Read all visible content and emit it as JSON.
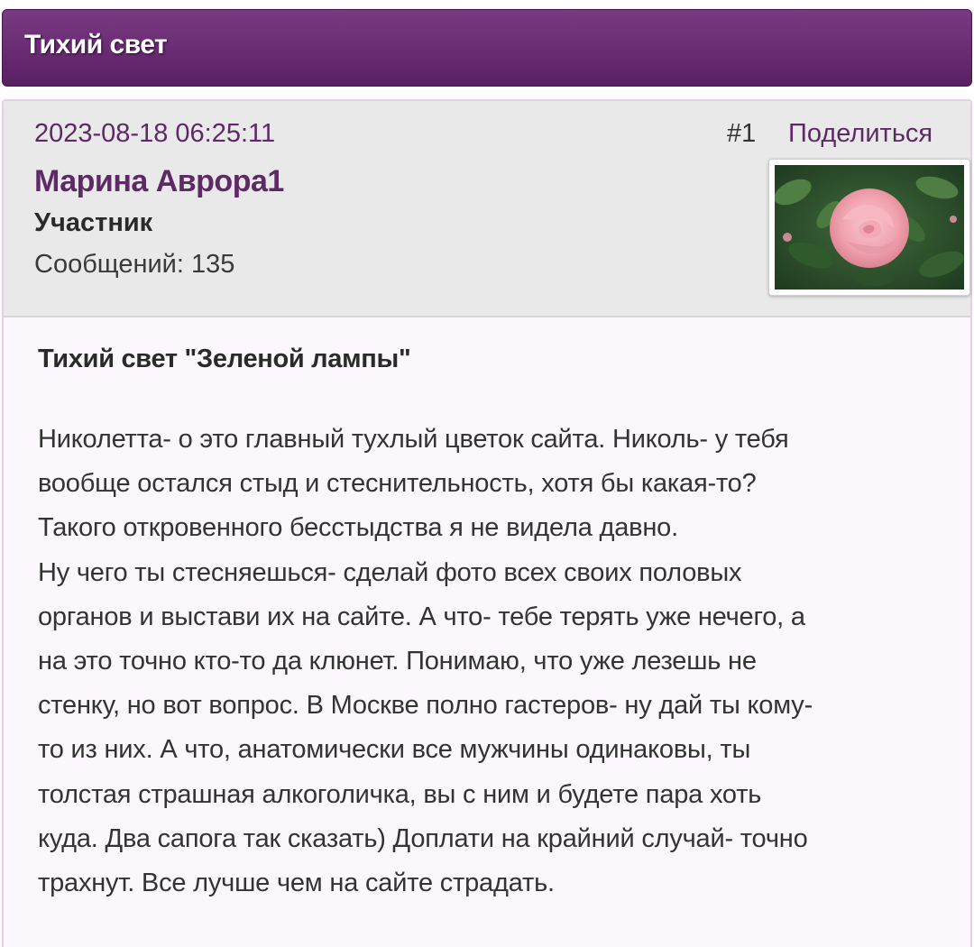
{
  "topic": {
    "title": "Тихий свет"
  },
  "post": {
    "date": "2023-08-18 06:25:11",
    "number": "#1",
    "share_label": "Поделиться",
    "author": {
      "name": "Марина Аврора1",
      "role": "Участник",
      "posts_label": "Сообщений: 135",
      "avatar_icon": "rose-avatar"
    },
    "title": "Тихий свет \"Зеленой лампы\"",
    "lines": [
      "Николетта- о это главный тухлый цветок сайта. Николь- у тебя",
      "вообще остался стыд и стеснительность, хотя бы какая-то?",
      "Такого откровенного бесстыдства я не видела давно.",
      "Ну чего ты стесняешься- сделай фото всех своих половых",
      "органов и выстави их на сайте. А что- тебе терять уже нечего, а",
      "на это точно кто-то да клюнет. Понимаю, что уже лезешь не",
      "стенку, но вот вопрос. В Москве полно гастеров- ну дай ты кому-",
      "то из них. А что, анатомически все мужчины одинаковы, ты",
      "толстая страшная алкоголичка, вы с ним и будете пара хоть",
      "куда. Два сапога так сказать) Доплати на крайний случай- точно",
      "трахнут. Все лучше чем на сайте страдать."
    ]
  },
  "colors": {
    "header_bg": "#6b2c74",
    "accent": "#5d2a66",
    "post_head_bg": "#e9e9e9",
    "post_body_bg": "#fbf7fc"
  }
}
